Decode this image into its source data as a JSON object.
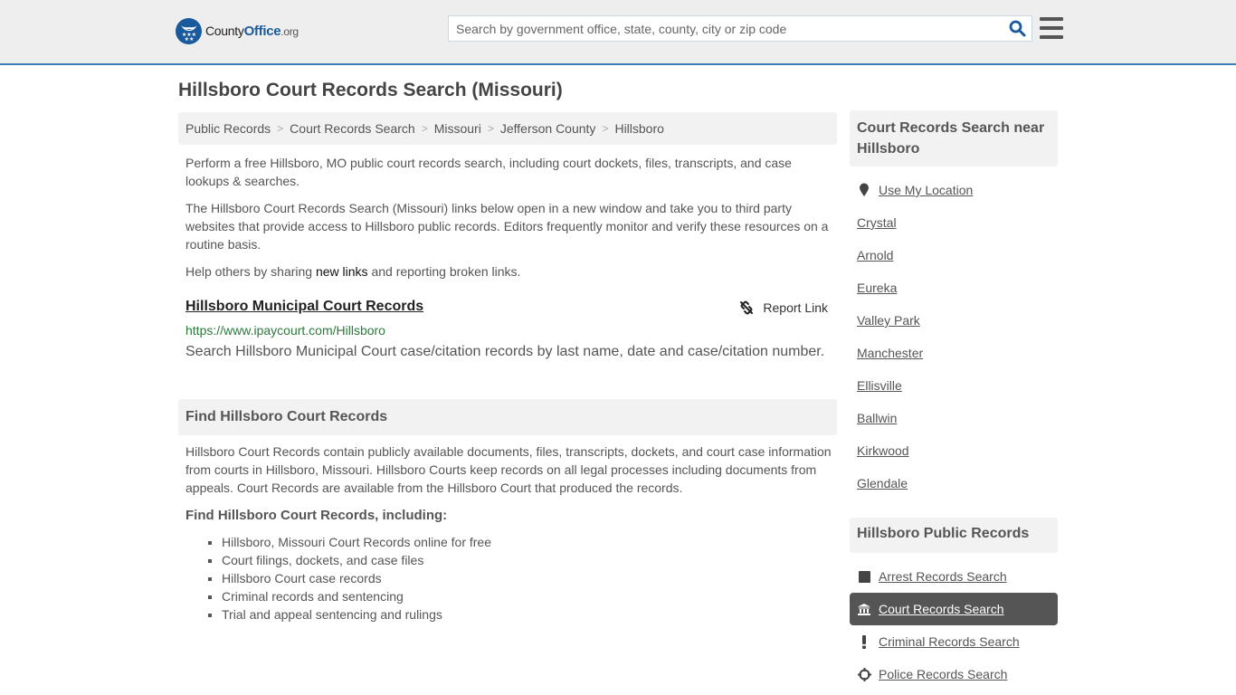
{
  "header": {
    "logo": {
      "county": "County",
      "office": "Office",
      "org": ".org"
    },
    "search_placeholder": "Search by government office, state, county, city or zip code",
    "search_icon": "search-icon",
    "menu_icon": "hamburger-menu-icon"
  },
  "page": {
    "title": "Hillsboro Court Records Search (Missouri)",
    "breadcrumb": [
      "Public Records",
      "Court Records Search",
      "Missouri",
      "Jefferson County",
      "Hillsboro"
    ],
    "intro": [
      "Perform a free Hillsboro, MO public court records search, including court dockets, files, transcripts, and case lookups & searches.",
      "The Hillsboro Court Records Search (Missouri) links below open in a new window and take you to third party websites that provide access to Hillsboro public records. Editors frequently monitor and verify these resources on a routine basis."
    ],
    "help": {
      "before": "Help others by sharing ",
      "link": "new links",
      "after": " and reporting broken links."
    }
  },
  "result": {
    "title": "Hillsboro Municipal Court Records",
    "url": "https://www.ipaycourt.com/Hillsboro",
    "description": "Search Hillsboro Municipal Court case/citation records by last name, date and case/citation number.",
    "report_label": "Report Link"
  },
  "find_section": {
    "heading": "Find Hillsboro Court Records",
    "body": "Hillsboro Court Records contain publicly available documents, files, transcripts, dockets, and court case information from courts in Hillsboro, Missouri. Hillsboro Courts keep records on all legal processes including documents from appeals. Court Records are available from the Hillsboro Court that produced the records.",
    "subheading": "Find Hillsboro Court Records, including:",
    "items": [
      "Hillsboro, Missouri Court Records online for free",
      "Court filings, dockets, and case files",
      "Hillsboro Court case records",
      "Criminal records and sentencing",
      "Trial and appeal sentencing and rulings"
    ]
  },
  "sidebar": {
    "nearby_heading": "Court Records Search near Hillsboro",
    "use_location": "Use My Location",
    "nearby": [
      "Crystal",
      "Arnold",
      "Eureka",
      "Valley Park",
      "Manchester",
      "Ellisville",
      "Ballwin",
      "Kirkwood",
      "Glendale"
    ],
    "public_heading": "Hillsboro Public Records",
    "public_links": [
      {
        "label": "Arrest Records Search",
        "icon": "square-icon",
        "active": false
      },
      {
        "label": "Court Records Search",
        "icon": "courthouse-icon",
        "active": true
      },
      {
        "label": "Criminal Records Search",
        "icon": "exclamation-icon",
        "active": false
      },
      {
        "label": "Police Records Search",
        "icon": "crosshair-icon",
        "active": false
      }
    ]
  },
  "colors": {
    "brand": "#1a5a9c",
    "header_border": "#3a7db5",
    "url_green": "#2a7a3a",
    "active_bg": "#555555"
  }
}
